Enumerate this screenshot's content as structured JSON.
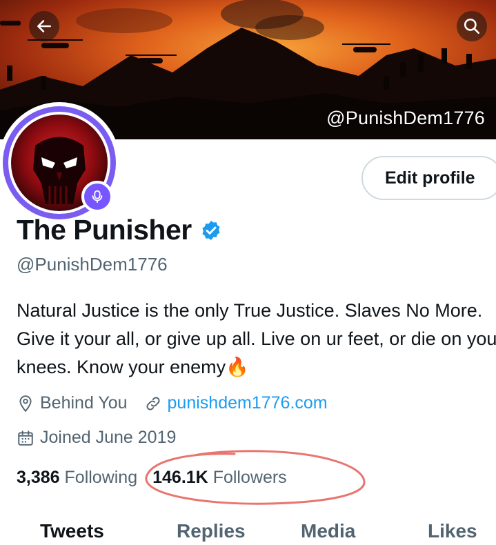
{
  "banner": {
    "handle_overlay": "@PunishDem1776"
  },
  "profile": {
    "edit_button": "Edit profile",
    "name": "The Punisher",
    "handle": "@PunishDem1776",
    "bio": "Natural Justice is the only True Justice. Slaves No More. Give it your all, or give up all. Live on ur feet, or die on your knees. Know your enemy",
    "bio_emoji": "🔥",
    "location": "Behind You",
    "website": "punishdem1776.com",
    "joined": "Joined June 2019",
    "following_count": "3,386",
    "following_label": "Following",
    "followers_count": "146.1K",
    "followers_label": "Followers"
  },
  "tabs": [
    {
      "label": "Tweets"
    },
    {
      "label": "Replies"
    },
    {
      "label": "Media"
    },
    {
      "label": "Likes"
    }
  ],
  "icons": {
    "back": "arrow-left-icon",
    "search": "search-icon",
    "verified": "verified-badge-icon",
    "location": "location-pin-icon",
    "link": "link-icon",
    "calendar": "calendar-icon",
    "spaces": "spaces-mic-icon"
  },
  "colors": {
    "accent": "#1d9bf0",
    "ring": "#7b5cf0",
    "annotation": "#e8766e"
  }
}
